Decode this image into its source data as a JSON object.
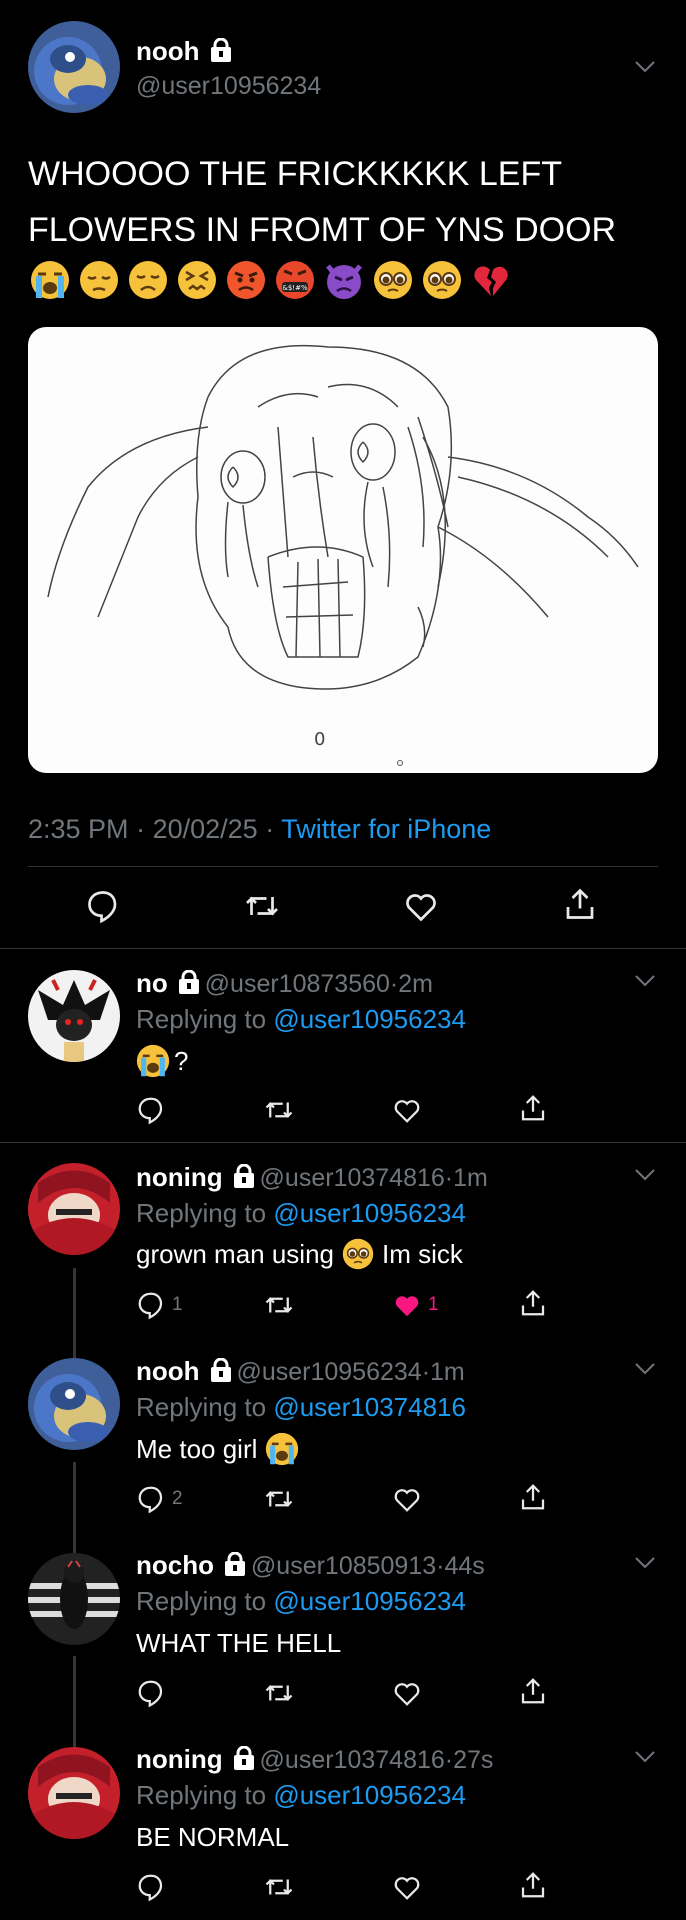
{
  "main_tweet": {
    "name": "nooh",
    "handle": "@user10956234",
    "text_line1": "WHOOOO THE FRICKKKKK LEFT",
    "text_line2": "FLOWERS IN FROMT OF YNS DOOR",
    "emoji_icons": [
      "loudly-crying-face-icon",
      "pensive-face-icon",
      "disappointed-face-icon",
      "confounded-face-icon",
      "pouting-face-icon",
      "cursing-face-icon",
      "angry-devil-icon",
      "pleading-face-icon",
      "pleading-face-icon",
      "broken-heart-icon"
    ],
    "time": "2:35 PM",
    "date": "20/02/25",
    "sep": "·",
    "source": "Twitter for iPhone",
    "image_label": "0"
  },
  "replies": [
    {
      "name": "no",
      "handle": "@user10873560",
      "time": "2m",
      "replying_label": "Replying to",
      "replying_to": "@user10956234",
      "text": "?",
      "text_emoji": "loudly-crying-face-icon",
      "reply_count": "",
      "like_count": "",
      "liked": false
    },
    {
      "name": "noning",
      "handle": "@user10374816",
      "time": "1m",
      "replying_label": "Replying to",
      "replying_to": "@user10956234",
      "text_before": "grown man using",
      "text_after": "Im sick",
      "text_emoji": "pleading-face-icon",
      "reply_count": "1",
      "like_count": "1",
      "liked": true
    },
    {
      "name": "nooh",
      "handle": "@user10956234",
      "time": "1m",
      "replying_label": "Replying to",
      "replying_to": "@user10374816",
      "text": "Me too girl",
      "text_emoji": "loudly-crying-face-icon",
      "reply_count": "2",
      "like_count": "",
      "liked": false
    },
    {
      "name": "nocho",
      "handle": "@user10850913",
      "time": "44s",
      "replying_label": "Replying to",
      "replying_to": "@user10956234",
      "text": "WHAT THE HELL",
      "reply_count": "",
      "like_count": "",
      "liked": false
    },
    {
      "name": "noning",
      "handle": "@user10374816",
      "time": "27s",
      "replying_label": "Replying to",
      "replying_to": "@user10956234",
      "text": "BE NORMAL",
      "reply_count": "",
      "like_count": "",
      "liked": false
    }
  ],
  "colors": {
    "background": "#000000",
    "accent": "#1d9bf0",
    "muted": "#71767b",
    "like": "#f91880"
  }
}
